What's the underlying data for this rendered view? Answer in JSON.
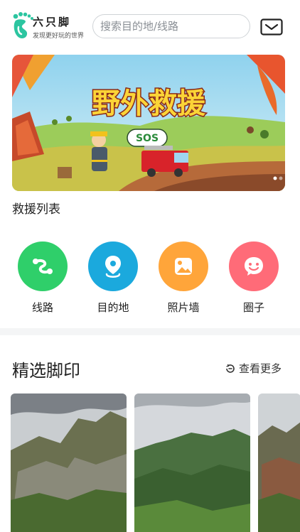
{
  "header": {
    "brand_name": "六只脚",
    "brand_slogan": "发现更好玩的世界",
    "search_placeholder": "搜索目的地/线路"
  },
  "banner": {
    "title": "野外救援",
    "badge": "SOS"
  },
  "rescue_list_title": "救援列表",
  "shortcuts": [
    {
      "label": "线路",
      "color": "#2fcf6a"
    },
    {
      "label": "目的地",
      "color": "#1ba9dd"
    },
    {
      "label": "照片墙",
      "color": "#ffa53a"
    },
    {
      "label": "圈子",
      "color": "#ff6b78"
    }
  ],
  "featured": {
    "title": "精选脚印",
    "more_label": "查看更多"
  },
  "colors": {
    "brand": "#2cc5a0"
  }
}
